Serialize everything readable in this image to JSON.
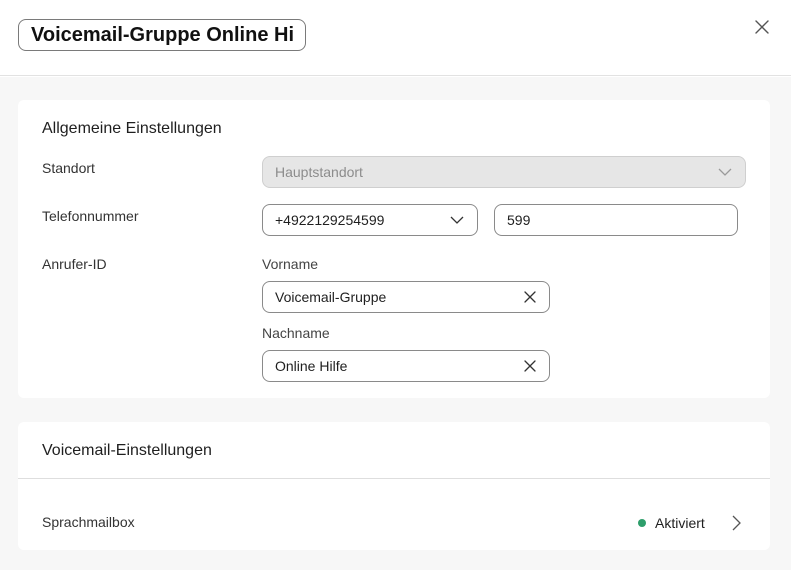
{
  "header": {
    "title_value": "Voicemail-Gruppe Online Hilfe"
  },
  "general": {
    "title": "Allgemeine Einstellungen",
    "location": {
      "label": "Standort",
      "value": "Hauptstandort"
    },
    "phone": {
      "label": "Telefonnummer",
      "number": "+4922129254599",
      "extension": "599"
    },
    "caller_id": {
      "label": "Anrufer-ID",
      "first_name_label": "Vorname",
      "first_name_value": "Voicemail-Gruppe",
      "last_name_label": "Nachname",
      "last_name_value": "Online Hilfe"
    }
  },
  "voicemail": {
    "title": "Voicemail-Einstellungen",
    "mailbox": {
      "label": "Sprachmailbox",
      "status": "Aktiviert",
      "status_color": "#2e9e6b"
    }
  },
  "icons": {
    "close": "close-icon",
    "dropdown": "chevron-down-icon",
    "clear": "clear-icon",
    "navigate": "chevron-right-icon"
  }
}
